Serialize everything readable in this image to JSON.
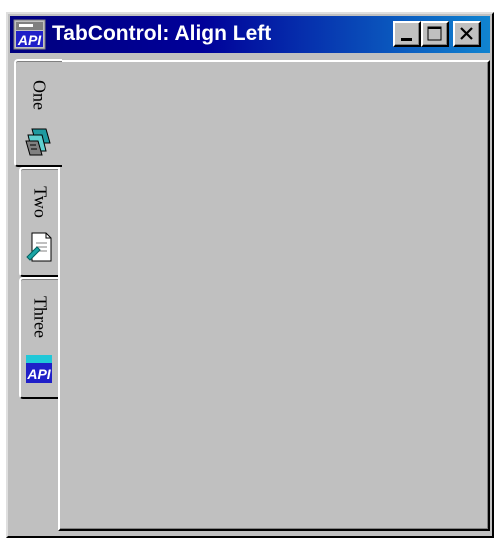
{
  "window": {
    "title": "TabControl: Align Left",
    "app_icon": "api-viewer-icon",
    "title_gradient": [
      "#00007e",
      "#1084d0"
    ]
  },
  "titlebar_buttons": {
    "minimize": "minimize-icon",
    "maximize": "maximize-icon",
    "close": "close-icon"
  },
  "tabs": [
    {
      "label": "One",
      "icon": "cards-icon",
      "selected": true
    },
    {
      "label": "Two",
      "icon": "document-icon",
      "selected": false
    },
    {
      "label": "Three",
      "icon": "api-icon",
      "selected": false
    }
  ],
  "colors": {
    "face": "#c0c0c0",
    "highlight": "#ffffff",
    "shadow": "#808080",
    "dark_shadow": "#000000"
  }
}
